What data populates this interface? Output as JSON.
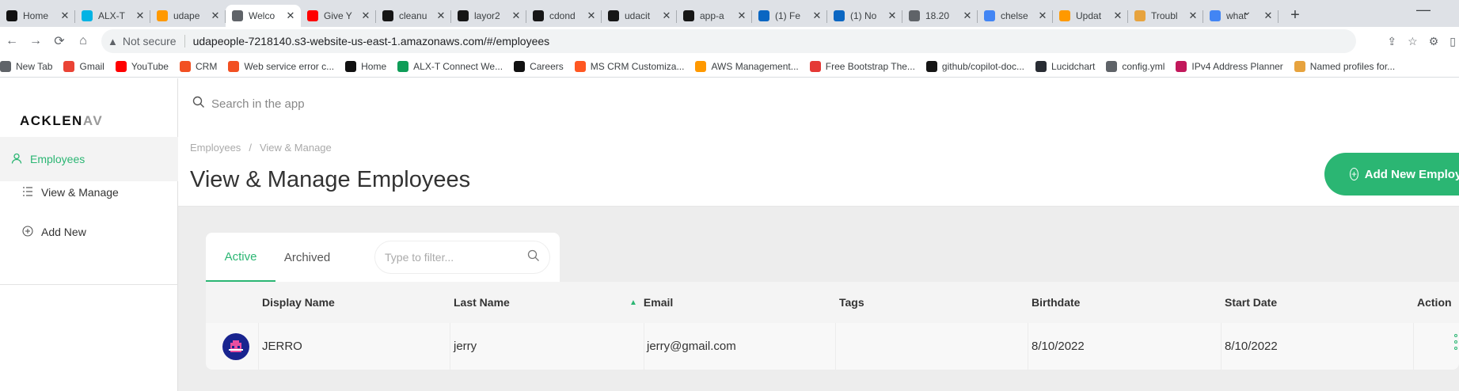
{
  "browser": {
    "tabs": [
      {
        "title": "Home",
        "icon": "alx-icon",
        "color": "#111111"
      },
      {
        "title": "ALX-T",
        "icon": "udacity-icon",
        "color": "#02b3e4"
      },
      {
        "title": "udape",
        "icon": "aws-icon",
        "color": "#ff9900"
      },
      {
        "title": "Welco",
        "icon": "globe-icon",
        "color": "#5f6368",
        "active": true
      },
      {
        "title": "Give Y",
        "icon": "youtube-icon",
        "color": "#ff0000"
      },
      {
        "title": "cleanu",
        "icon": "circleci-icon",
        "color": "#161616"
      },
      {
        "title": "layor2",
        "icon": "github-icon",
        "color": "#161616"
      },
      {
        "title": "cdond",
        "icon": "github-icon",
        "color": "#161616"
      },
      {
        "title": "udacit",
        "icon": "github-icon",
        "color": "#161616"
      },
      {
        "title": "app-a",
        "icon": "github-icon",
        "color": "#161616"
      },
      {
        "title": "(1) Fe",
        "icon": "linkedin-icon",
        "color": "#0a66c2"
      },
      {
        "title": "(1) No",
        "icon": "linkedin-icon",
        "color": "#0a66c2"
      },
      {
        "title": "18.20",
        "icon": "globe-icon",
        "color": "#5f6368"
      },
      {
        "title": "chelse",
        "icon": "google-icon",
        "color": "#4285f4"
      },
      {
        "title": "Updat",
        "icon": "aws-icon",
        "color": "#ff9900"
      },
      {
        "title": "Troubl",
        "icon": "aws-docs-icon",
        "color": "#e7a33e"
      },
      {
        "title": "what",
        "icon": "google-icon",
        "color": "#4285f4"
      }
    ],
    "address": {
      "security_label": "Not secure",
      "url": "udapeople-7218140.s3-website-us-east-1.amazonaws.com/#/employees"
    },
    "bookmarks": [
      {
        "label": "New Tab",
        "icon": "globe-icon",
        "color": "#5f6368"
      },
      {
        "label": "Gmail",
        "icon": "gmail-icon",
        "color": "#ea4335"
      },
      {
        "label": "YouTube",
        "icon": "youtube-icon",
        "color": "#ff0000"
      },
      {
        "label": "CRM",
        "icon": "windows-icon",
        "color": "#f25022"
      },
      {
        "label": "Web service error c...",
        "icon": "windows-icon",
        "color": "#f25022"
      },
      {
        "label": "Home",
        "icon": "alx-icon",
        "color": "#111111"
      },
      {
        "label": "ALX-T Connect We...",
        "icon": "sheets-icon",
        "color": "#0f9d58"
      },
      {
        "label": "Careers",
        "icon": "alx-icon",
        "color": "#111111"
      },
      {
        "label": "MS CRM Customiza...",
        "icon": "blogger-icon",
        "color": "#ff5722"
      },
      {
        "label": "AWS Management...",
        "icon": "aws-icon",
        "color": "#ff9900"
      },
      {
        "label": "Free Bootstrap The...",
        "icon": "s-icon",
        "color": "#e53935"
      },
      {
        "label": "github/copilot-doc...",
        "icon": "github-icon",
        "color": "#161616"
      },
      {
        "label": "Lucidchart",
        "icon": "lucid-icon",
        "color": "#282c33"
      },
      {
        "label": "config.yml",
        "icon": "globe-icon",
        "color": "#5f6368"
      },
      {
        "label": "IPv4 Address Planner",
        "icon": "v-icon",
        "color": "#c2185b"
      },
      {
        "label": "Named profiles for...",
        "icon": "aws-docs-icon",
        "color": "#e7a33e"
      }
    ]
  },
  "app": {
    "logo_main": "ACKLEN",
    "logo_fade": "AV",
    "search_placeholder": "Search in the app",
    "accent": "#2bb673",
    "sidebar": [
      {
        "label": "Employees",
        "icon": "person-icon",
        "active": true
      },
      {
        "label": "View & Manage",
        "icon": "list-icon"
      },
      {
        "label": "Add New",
        "icon": "plus-circle-icon"
      }
    ],
    "breadcrumb": [
      "Employees",
      "View & Manage"
    ],
    "page_title": "View & Manage Employees",
    "add_button": "Add New Employee",
    "tabs": [
      "Active",
      "Archived"
    ],
    "filter_placeholder": "Type to filter...",
    "columns": [
      "Display Name",
      "Last Name",
      "Email",
      "Tags",
      "Birthdate",
      "Start Date",
      "Action"
    ],
    "rows": [
      {
        "display_name": "JERRO",
        "last_name": "jerry",
        "email": "jerry@gmail.com",
        "tags": "",
        "birthdate": "8/10/2022",
        "start_date": "8/10/2022"
      }
    ]
  }
}
